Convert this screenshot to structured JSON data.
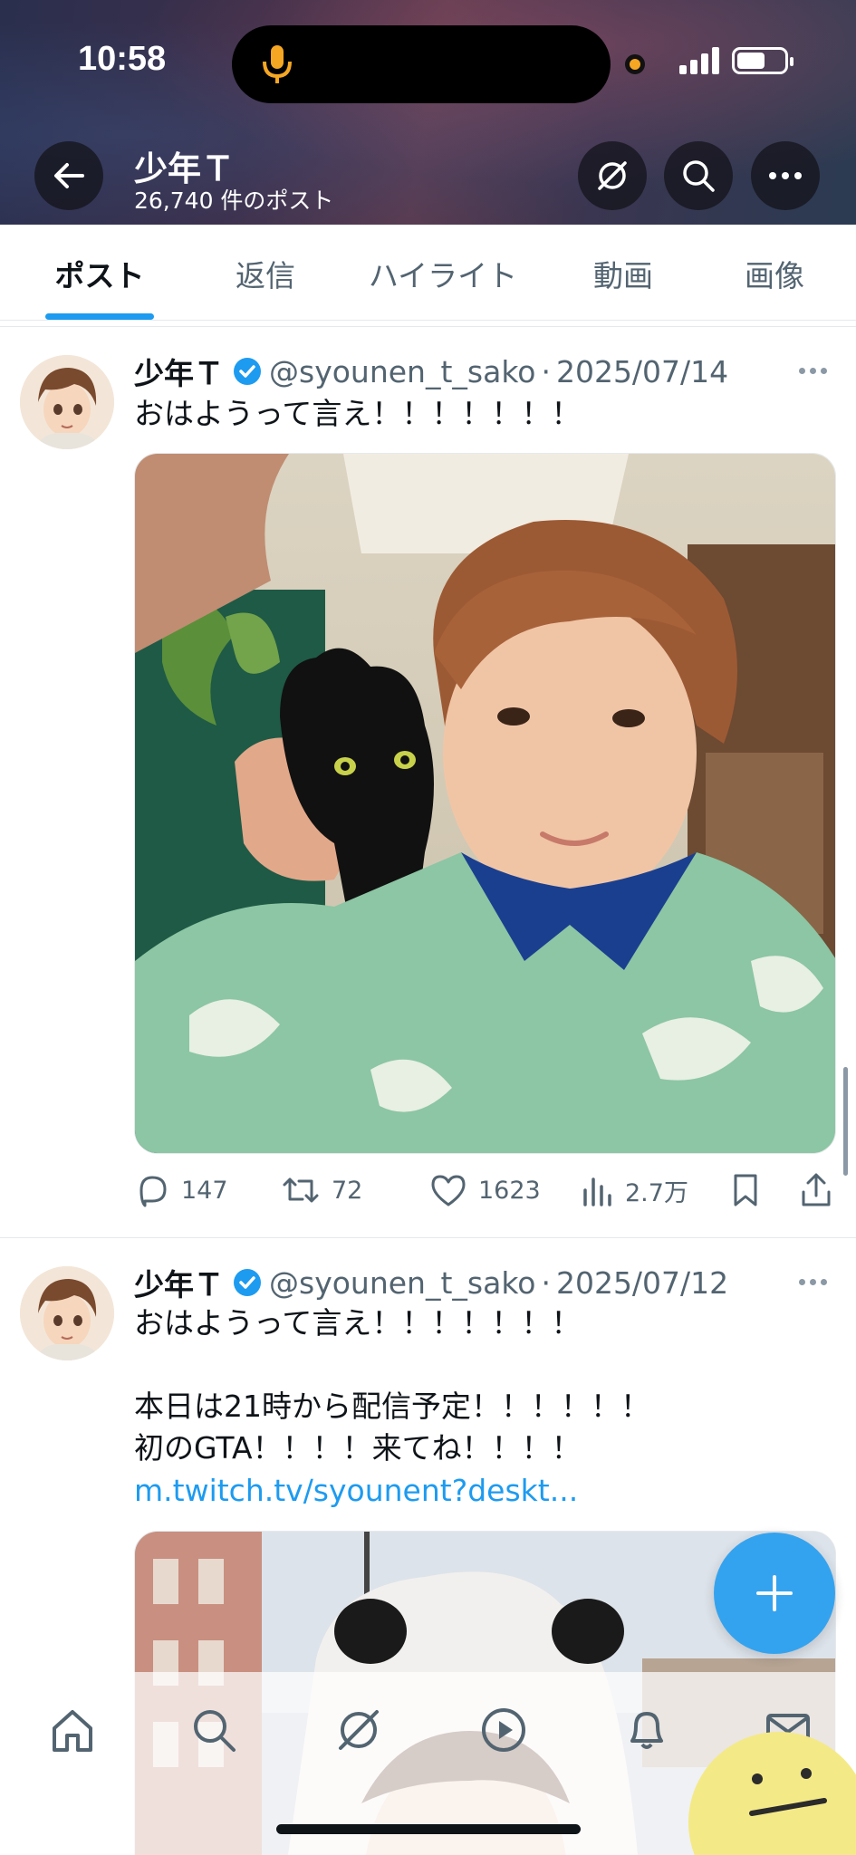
{
  "status_bar": {
    "time": "10:58"
  },
  "header": {
    "title": "少年Ｔ",
    "subtitle": "26,740 件のポスト"
  },
  "tabs": [
    {
      "label": "ポスト",
      "active": true
    },
    {
      "label": "返信",
      "active": false
    },
    {
      "label": "ハイライト",
      "active": false
    },
    {
      "label": "動画",
      "active": false
    },
    {
      "label": "画像",
      "active": false
    }
  ],
  "posts": [
    {
      "name": "少年Ｔ",
      "handle": "@syounen_t_sako",
      "separator": "·",
      "date": "2025/07/14",
      "text": "おはようって言え！！！！！！！",
      "media_description": "selfie with black cat on shoulder",
      "stats": {
        "replies": "147",
        "reposts": "72",
        "likes": "1623",
        "views": "2.7万"
      }
    },
    {
      "name": "少年Ｔ",
      "handle": "@syounen_t_sako",
      "separator": "·",
      "date": "2025/07/12",
      "text": "おはようって言え！！！！！！！\n\n本日は21時から配信予定！！！！！！\n初のGTA！！！！来てね！！！！",
      "link": "m.twitch.tv/syounent?deskt...",
      "media_description": "photo wearing panda hood"
    }
  ],
  "colors": {
    "accent": "#1d9bf0",
    "text": "#0f1419",
    "muted": "#536471"
  },
  "bottom_nav": [
    "home-icon",
    "search-icon",
    "grok-icon",
    "video-icon",
    "notifications-icon",
    "messages-icon"
  ]
}
